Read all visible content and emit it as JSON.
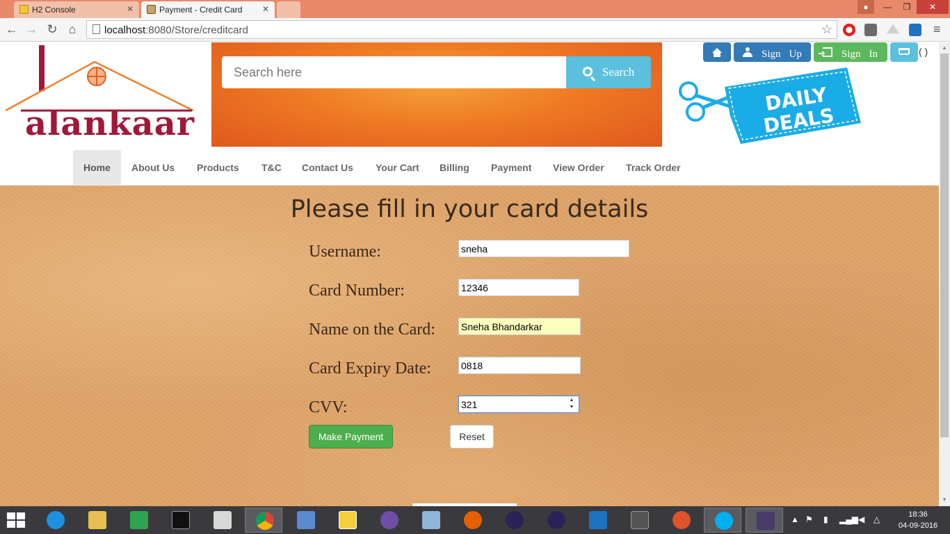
{
  "browser": {
    "tabs": [
      {
        "label": "H2 Console"
      },
      {
        "label": "Payment - Credit Card"
      }
    ],
    "url_host": "localhost",
    "url_path": ":8080/Store/creditcard"
  },
  "header": {
    "logo_text": "alankaar",
    "search_placeholder": "Search here",
    "search_button": "Search",
    "signup_word1": "Sign",
    "signup_word2": "Up",
    "signin_word1": "Sign",
    "signin_word2": "In",
    "cart_count": "( )",
    "deals_line1": "DAILY",
    "deals_line2": "DEALS"
  },
  "nav": {
    "items": [
      {
        "label": "Home"
      },
      {
        "label": "About Us"
      },
      {
        "label": "Products"
      },
      {
        "label": "T&C"
      },
      {
        "label": "Contact Us"
      },
      {
        "label": "Your Cart"
      },
      {
        "label": "Billing"
      },
      {
        "label": "Payment"
      },
      {
        "label": "View Order"
      },
      {
        "label": "Track Order"
      }
    ]
  },
  "form": {
    "title": "Please fill in your card details",
    "username_label": "Username:",
    "username_value": "sneha",
    "card_number_label": "Card Number:",
    "card_number_value": "12346",
    "name_label": "Name on the Card:",
    "name_value": "Sneha Bhandarkar",
    "expiry_label": "Card Expiry Date:",
    "expiry_value": "0818",
    "cvv_label": "CVV:",
    "cvv_value": "321",
    "make_payment": "Make Payment",
    "reset": "Reset"
  },
  "taskbar": {
    "time": "18:36",
    "date": "04-09-2016"
  },
  "colors": {
    "primary": "#337ab7",
    "success": "#5cb85c",
    "info": "#5bc0de",
    "brand": "#a01838"
  }
}
